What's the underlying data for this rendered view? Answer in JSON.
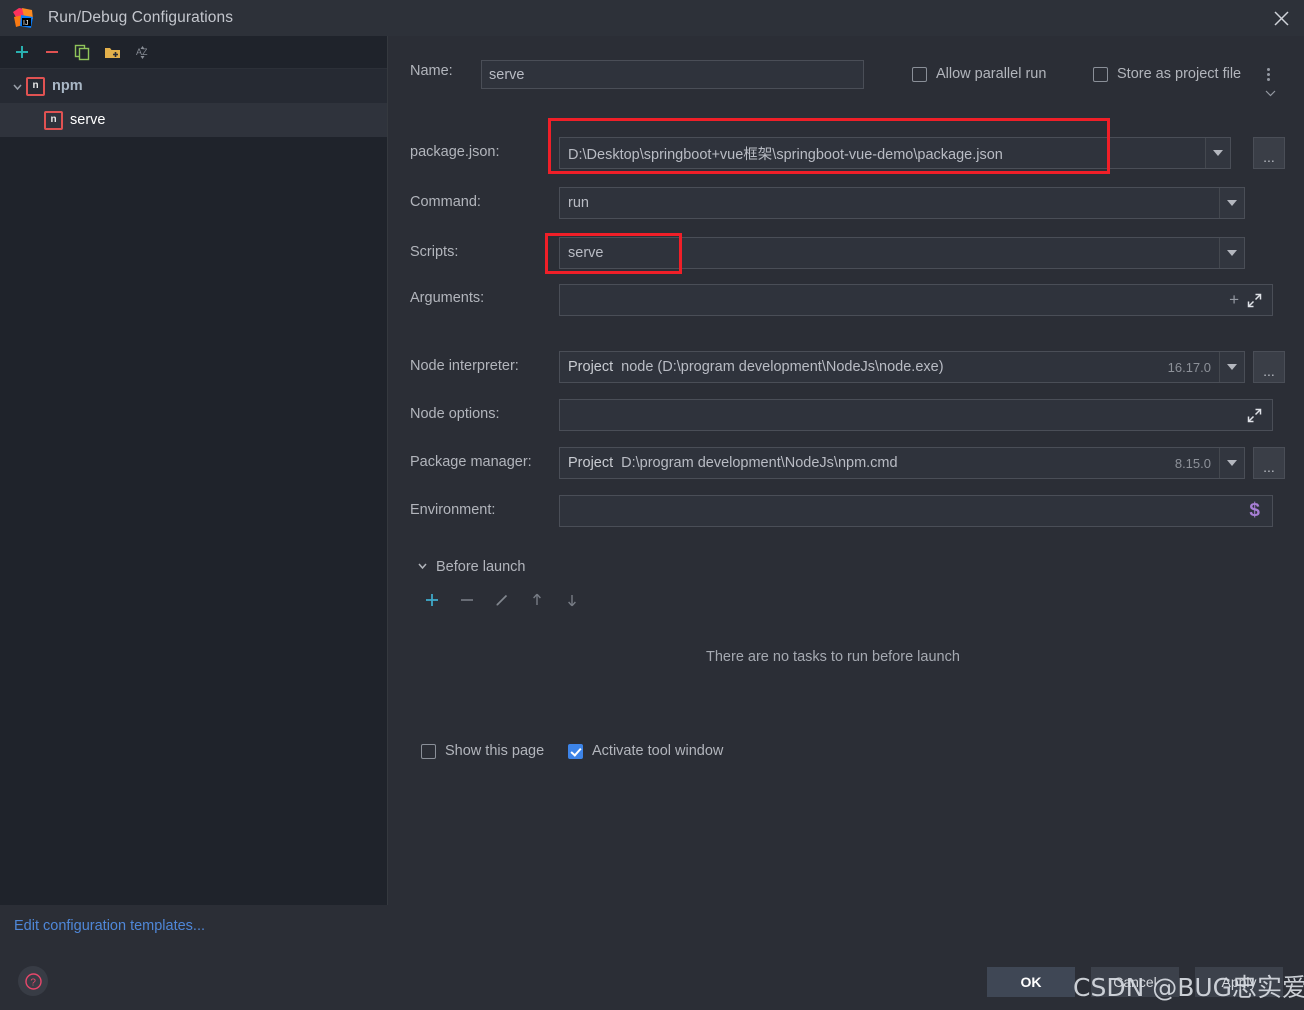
{
  "window": {
    "title": "Run/Debug Configurations",
    "app_icon": "intellij-idea-logo",
    "close_icon": "close-icon"
  },
  "left_panel": {
    "toolbar": [
      {
        "name": "add-configuration-button",
        "icon": "plus-icon",
        "color": "#29b0b0"
      },
      {
        "name": "remove-configuration-button",
        "icon": "minus-icon",
        "color": "#e05252"
      },
      {
        "name": "copy-configuration-button",
        "icon": "copy-icon",
        "color": "#8fc45a"
      },
      {
        "name": "new-folder-button",
        "icon": "folder-plus-icon",
        "color": "#e3b04b"
      },
      {
        "name": "sort-configurations-button",
        "icon": "sort-az-icon",
        "color": "#888d96"
      }
    ],
    "tree": [
      {
        "label": "npm",
        "icon": "npm-icon",
        "icon_letter": "n",
        "type": "group",
        "expanded": true,
        "chevron": "chevron-down-icon"
      },
      {
        "label": "serve",
        "icon": "npm-icon",
        "icon_letter": "n",
        "type": "item",
        "selected": true
      }
    ],
    "edit_templates_link": "Edit configuration templates...",
    "help_icon": "help-question-icon"
  },
  "form": {
    "name_label": "Name:",
    "name_value": "serve",
    "allow_parallel_run_label": "Allow parallel run",
    "allow_parallel_run_checked": false,
    "store_as_project_file_label": "Store as project file",
    "store_as_project_file_checked": false,
    "options_menu_icon": "kebab-menu-icon",
    "package_json_label": "package.json:",
    "package_json_value": "D:\\Desktop\\springboot+vue框架\\springboot-vue-demo\\package.json",
    "package_json_browse": "...",
    "command_label": "Command:",
    "command_value": "run",
    "scripts_label": "Scripts:",
    "scripts_value": "serve",
    "arguments_label": "Arguments:",
    "arguments_value": "",
    "arguments_add_icon": "plus-icon",
    "arguments_expand_icon": "expand-icon",
    "node_interpreter_label": "Node interpreter:",
    "node_interpreter_scope": "Project",
    "node_interpreter_value": "node (D:\\program development\\NodeJs\\node.exe)",
    "node_interpreter_version": "16.17.0",
    "node_interpreter_browse": "...",
    "node_options_label": "Node options:",
    "node_options_value": "",
    "node_options_expand_icon": "expand-icon",
    "package_manager_label": "Package manager:",
    "package_manager_scope": "Project",
    "package_manager_value": "D:\\program development\\NodeJs\\npm.cmd",
    "package_manager_version": "8.15.0",
    "package_manager_browse": "...",
    "environment_label": "Environment:",
    "environment_value": "",
    "environment_icon": "dollar-variables-icon"
  },
  "before_launch": {
    "title": "Before launch",
    "chevron": "chevron-down-icon",
    "toolbar": [
      {
        "name": "add-task-button",
        "icon": "plus-icon",
        "color": "#3fa9c9"
      },
      {
        "name": "remove-task-button",
        "icon": "minus-icon",
        "color": "#777c85"
      },
      {
        "name": "edit-task-button",
        "icon": "pencil-icon",
        "color": "#777c85"
      },
      {
        "name": "move-task-up-button",
        "icon": "arrow-up-icon",
        "color": "#777c85"
      },
      {
        "name": "move-task-down-button",
        "icon": "arrow-down-icon",
        "color": "#777c85"
      }
    ],
    "empty_text": "There are no tasks to run before launch",
    "show_this_page_label": "Show this page",
    "show_this_page_checked": false,
    "activate_tool_window_label": "Activate tool window",
    "activate_tool_window_checked": true
  },
  "footer": {
    "ok_label": "OK",
    "cancel_label": "Cancel",
    "apply_label": "Apply"
  },
  "annotations": {
    "color": "#f01f28",
    "boxes": [
      "package-json-field",
      "scripts-field"
    ]
  },
  "watermark": "CSDN @BUG忠实爱好者"
}
